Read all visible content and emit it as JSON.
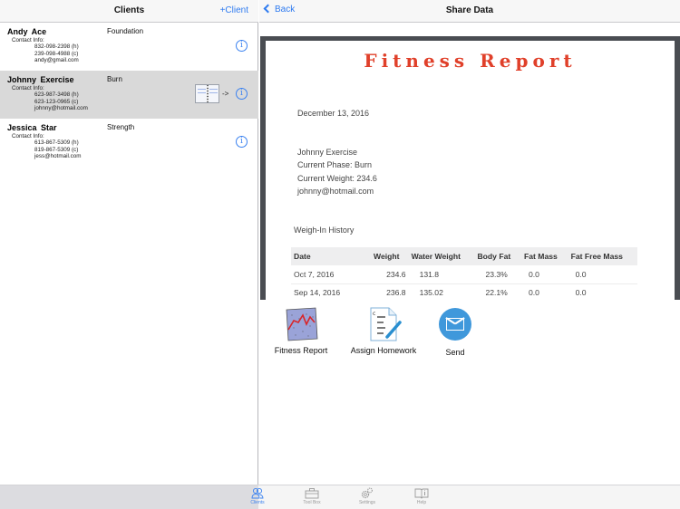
{
  "clients_panel": {
    "title": "Clients",
    "add_label": "+Client",
    "clients": [
      {
        "name": "Andy  Ace",
        "phase": "Foundation",
        "contact_label": "Contact Info:",
        "phone_home": "832-098-2398 (h)",
        "phone_cell": "239-098-4988 (c)",
        "email": "andy@gmail.com",
        "selected": false
      },
      {
        "name": "Johnny  Exercise",
        "phase": "Burn",
        "contact_label": "Contact Info:",
        "phone_home": "623-987-3498 (h)",
        "phone_cell": "623-123-0965 (c)",
        "email": "johnny@hotmail.com",
        "selected": true,
        "arrow": "->"
      },
      {
        "name": "Jessica  Star",
        "phase": "Strength",
        "contact_label": "Contact Info:",
        "phone_home": "613-867-5309 (h)",
        "phone_cell": "819-867-5309 (c)",
        "email": "jess@hotmail.com",
        "selected": false
      }
    ]
  },
  "share_panel": {
    "back_label": "Back",
    "title": "Share Data",
    "document": {
      "title": "Fitness Report",
      "date": "December 13, 2016",
      "client_name": "Johnny Exercise",
      "current_phase": "Current Phase: Burn",
      "current_weight": "Current Weight: 234.6",
      "email": "johnny@hotmail.com",
      "history_heading": "Weigh-In History",
      "table": {
        "columns": [
          "Date",
          "Weight",
          "Water Weight",
          "Body Fat",
          "Fat Mass",
          "Fat Free Mass"
        ],
        "rows": [
          [
            "Oct 7, 2016",
            "234.6",
            "131.8",
            "23.3%",
            "0.0",
            "0.0"
          ],
          [
            "Sep 14, 2016",
            "236.8",
            "135.02",
            "22.1%",
            "0.0",
            "0.0"
          ]
        ]
      }
    },
    "actions": [
      {
        "label": "Fitness Report",
        "icon": "chart-icon"
      },
      {
        "label": "Assign Homework",
        "icon": "document-pen-icon"
      },
      {
        "label": "Send",
        "icon": "mail-icon"
      }
    ]
  },
  "tabbar": {
    "tabs": [
      {
        "label": "Clients",
        "icon": "people-icon",
        "active": true
      },
      {
        "label": "Tool Box",
        "icon": "toolbox-icon",
        "active": false
      },
      {
        "label": "Settings",
        "icon": "gears-icon",
        "active": false
      },
      {
        "label": "Help",
        "icon": "book-icon",
        "active": false
      }
    ]
  },
  "colors": {
    "accent": "#2f7bf0",
    "report_title": "#e0402a",
    "selected_row": "#d9d9d9",
    "doc_frame": "#4a4d52",
    "send_icon": "#3f98db"
  }
}
